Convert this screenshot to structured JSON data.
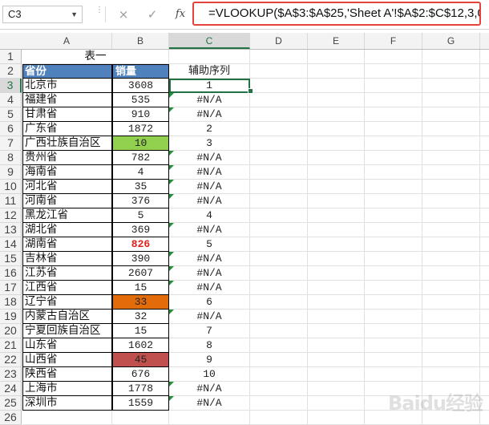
{
  "name_box": "C3",
  "formula_bar": {
    "cancel_icon": "×",
    "enter_icon": "✓",
    "fx_icon": "fx",
    "formula": "=VLOOKUP($A$3:$A$25,'Sheet A'!$A$2:$C$12,3,0)"
  },
  "columns": [
    "A",
    "B",
    "C",
    "D",
    "E",
    "F",
    "G"
  ],
  "title": "表一",
  "headers": {
    "province": "省份",
    "sales": "销量",
    "helper": "辅助序列"
  },
  "rows": [
    {
      "n": "3",
      "province": "北京市",
      "sales": "3608",
      "helper": "1"
    },
    {
      "n": "4",
      "province": "福建省",
      "sales": "535",
      "helper": "#N/A"
    },
    {
      "n": "5",
      "province": "甘肃省",
      "sales": "910",
      "helper": "#N/A"
    },
    {
      "n": "6",
      "province": "广东省",
      "sales": "1872",
      "helper": "2"
    },
    {
      "n": "7",
      "province": "广西壮族自治区",
      "sales": "10",
      "helper": "3"
    },
    {
      "n": "8",
      "province": "贵州省",
      "sales": "782",
      "helper": "#N/A"
    },
    {
      "n": "9",
      "province": "海南省",
      "sales": "4",
      "helper": "#N/A"
    },
    {
      "n": "10",
      "province": "河北省",
      "sales": "35",
      "helper": "#N/A"
    },
    {
      "n": "11",
      "province": "河南省",
      "sales": "376",
      "helper": "#N/A"
    },
    {
      "n": "12",
      "province": "黑龙江省",
      "sales": "5",
      "helper": "4"
    },
    {
      "n": "13",
      "province": "湖北省",
      "sales": "369",
      "helper": "#N/A"
    },
    {
      "n": "14",
      "province": "湖南省",
      "sales": "826",
      "helper": "5"
    },
    {
      "n": "15",
      "province": "吉林省",
      "sales": "390",
      "helper": "#N/A"
    },
    {
      "n": "16",
      "province": "江苏省",
      "sales": "2607",
      "helper": "#N/A"
    },
    {
      "n": "17",
      "province": "江西省",
      "sales": "15",
      "helper": "#N/A"
    },
    {
      "n": "18",
      "province": "辽宁省",
      "sales": "33",
      "helper": "6"
    },
    {
      "n": "19",
      "province": "内蒙古自治区",
      "sales": "32",
      "helper": "#N/A"
    },
    {
      "n": "20",
      "province": "宁夏回族自治区",
      "sales": "15",
      "helper": "7"
    },
    {
      "n": "21",
      "province": "山东省",
      "sales": "1602",
      "helper": "8"
    },
    {
      "n": "22",
      "province": "山西省",
      "sales": "45",
      "helper": "9"
    },
    {
      "n": "23",
      "province": "陕西省",
      "sales": "676",
      "helper": "10"
    },
    {
      "n": "24",
      "province": "上海市",
      "sales": "1778",
      "helper": "#N/A"
    },
    {
      "n": "25",
      "province": "深圳市",
      "sales": "1559",
      "helper": "#N/A"
    }
  ],
  "row_numbers_top": [
    "1",
    "2"
  ],
  "row_number_bottom": "26",
  "colors": {
    "header_fill": "#4f81bd",
    "green_fill": "#92d050",
    "orange_fill": "#e26b0a",
    "red_fill": "#c0504d",
    "red_text": "#e0201a",
    "selection": "#217346",
    "formula_box_border": "#e5423b"
  },
  "watermark": "Baidu经验"
}
